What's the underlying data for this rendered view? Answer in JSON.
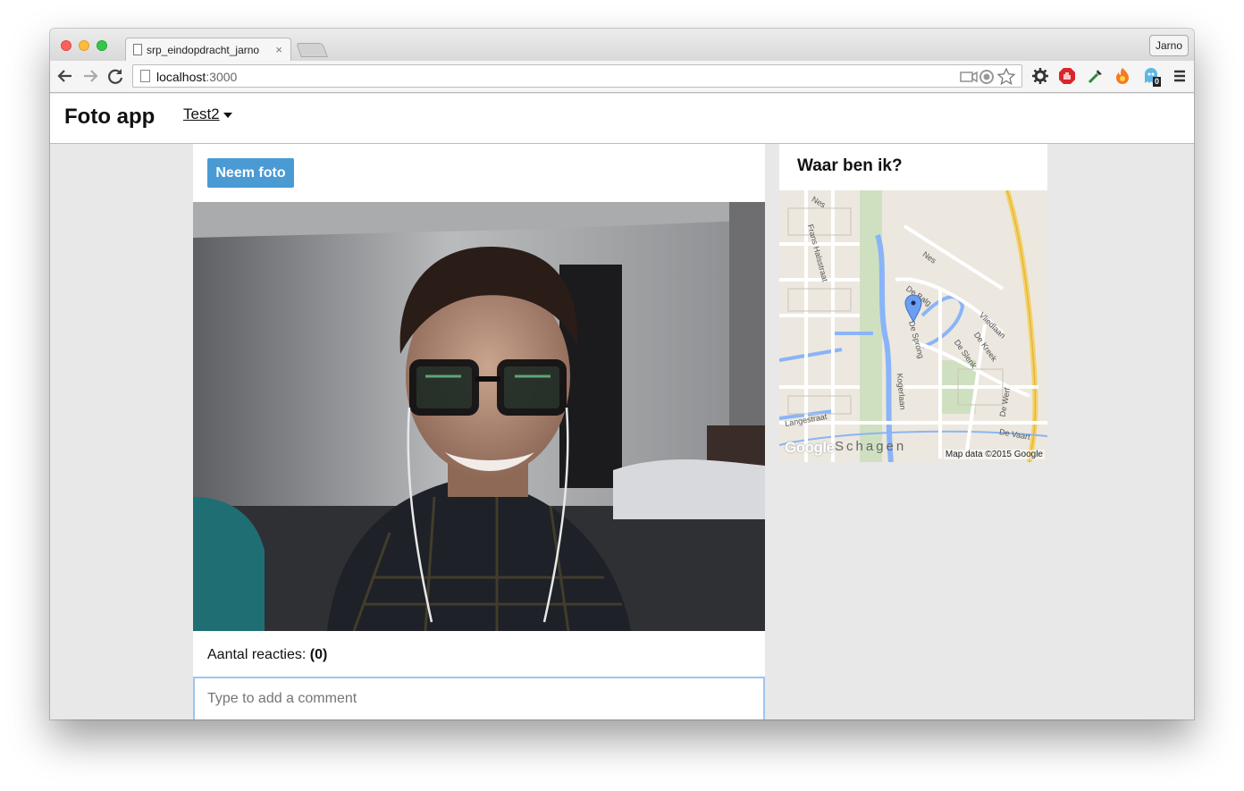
{
  "browser": {
    "tab_title": "srp_eindopdracht_jarno",
    "tab_close": "×",
    "profile": "Jarno",
    "url_host": "localhost",
    "url_port": ":3000",
    "extension_badge": "0"
  },
  "app": {
    "brand": "Foto app",
    "user_menu": "Test2"
  },
  "main": {
    "take_photo_label": "Neem foto",
    "reactions_label": "Aantal reacties:",
    "reactions_count": "(0)",
    "comment_placeholder": "Type to add a comment"
  },
  "map": {
    "title": "Waar ben ik?",
    "attribution": "Map data ©2015 Google",
    "google_logo": "Google",
    "labels": {
      "nes_top": "Nes",
      "nes_right": "Nes",
      "frans_hals": "Frans Halsstraat",
      "de_balg": "De Balg",
      "de_sprong": "De Sprong",
      "vliedlaan": "Vliedlaan",
      "de_kreek": "De Kreek",
      "de_slenk": "De Slenk",
      "kogerlaan": "Kogerlaan",
      "langestraat": "Langestraat",
      "de_werf": "De Werf",
      "de_vaart": "De Vaart",
      "schagen": "Schagen"
    }
  },
  "colors": {
    "button": "#4a9ad4",
    "comment_focus": "#9cc6f0",
    "page_bg": "#e8e8e8"
  }
}
